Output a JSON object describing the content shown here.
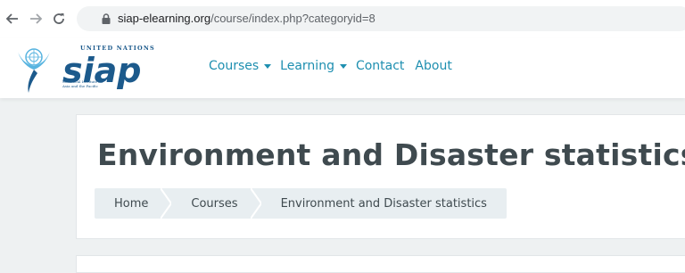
{
  "browser": {
    "url_host": "siap-elearning.org",
    "url_path": "/course/index.php?categoryid=8"
  },
  "header": {
    "logo_text": "UNITED NATIONS",
    "logo_sub_1": "Statistical Institute for",
    "logo_sub_2": "Asia and the Pacific",
    "nav": {
      "courses": "Courses",
      "learning": "Learning",
      "contact": "Contact",
      "about": "About"
    }
  },
  "page": {
    "title": "Environment and Disaster statistics",
    "breadcrumb": {
      "home": "Home",
      "courses": "Courses",
      "current": "Environment and Disaster statistics"
    }
  },
  "colors": {
    "brand": "#1c5a8c",
    "nav_link": "#1e8fb0",
    "logo_light_blue": "#58b4e0"
  }
}
